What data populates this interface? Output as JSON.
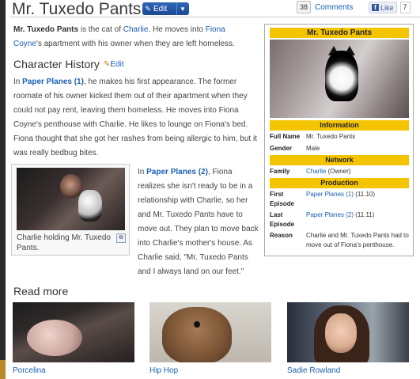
{
  "header": {
    "title": "Mr. Tuxedo Pants",
    "edit_label": "Edit",
    "comments_count": "38",
    "comments_label": "Comments",
    "fb_like_label": "Like",
    "fb_like_count": "7"
  },
  "intro": {
    "name_bold": "Mr. Tuxedo Pants",
    "t1": " is the cat of ",
    "link_charlie": "Charlie",
    "t2": ". He moves into ",
    "link_fiona": "Fiona Coyne",
    "t3": "'s apartment with his owner when they are left homeless."
  },
  "section": {
    "heading": "Character History",
    "edit_label": "Edit"
  },
  "para1": {
    "t1": "In ",
    "link": "Paper Planes (1)",
    "t2": ", he makes his first appearance. The former roomate of his owner kicked them out of their apartment when they could not pay rent, leaving them homeless. He moves into Fiona Coyne's penthouse with Charlie. He likes to lounge on Fiona's bed. Fiona thought that she got her rashes from being allergic to him, but it was really bedbug bites."
  },
  "para2": {
    "t1": "In ",
    "link": "Paper Planes (2)",
    "t2": ", Fiona realizes she isn't ready to be in a relationship with Charlie, so her and Mr. Tuxedo Pants have to move out. They plan to move back into Charlie's mother's house. As Charlie said, \"Mr. Tuxedo Pants and I always land on our feet.\""
  },
  "thumb": {
    "caption": "Charlie holding Mr. Tuxedo Pants."
  },
  "infobox": {
    "title": "Mr. Tuxedo Pants",
    "information_header": "Information",
    "full_name_key": "Full Name",
    "full_name_val": "Mr. Tuxedo Pants",
    "gender_key": "Gender",
    "gender_val": "Male",
    "network_header": "Network",
    "family_key": "Family",
    "family_link": "Charlie",
    "family_rel": " (Owner)",
    "production_header": "Production",
    "first_key": "First Episode",
    "first_link": "Paper Planes (1)",
    "first_num": " (11.10)",
    "last_key": "Last Episode",
    "last_link": "Paper Planes (2)",
    "last_num": " (11.11)",
    "reason_key": "Reason",
    "reason_val": "Charlie and Mr. Tuxedo Pants had to move out of Fiona's penthouse."
  },
  "read_more": {
    "title": "Read more",
    "items": [
      {
        "label": "Porcelina"
      },
      {
        "label": "Hip Hop"
      },
      {
        "label": "Sadie Rowland"
      }
    ]
  }
}
